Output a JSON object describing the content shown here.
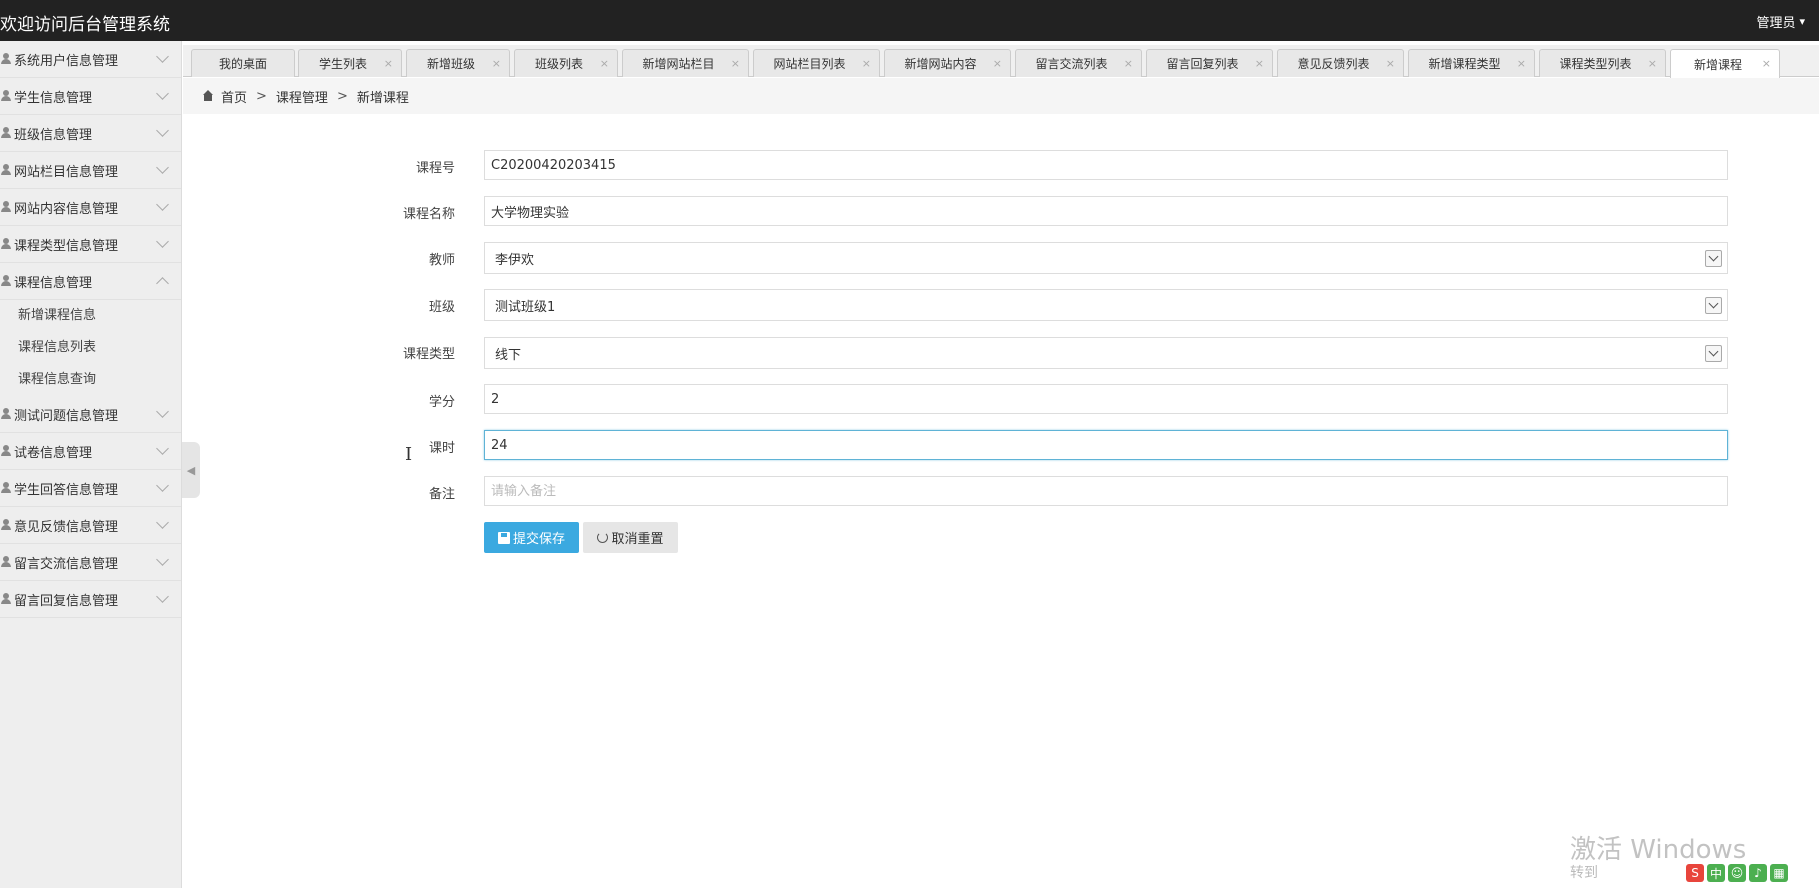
{
  "header": {
    "title": "欢迎访问后台管理系统",
    "user": "管理员"
  },
  "sidebar": {
    "items": [
      {
        "label": "系统用户信息管理"
      },
      {
        "label": "学生信息管理"
      },
      {
        "label": "班级信息管理"
      },
      {
        "label": "网站栏目信息管理"
      },
      {
        "label": "网站内容信息管理"
      },
      {
        "label": "课程类型信息管理"
      },
      {
        "label": "课程信息管理"
      },
      {
        "label": "测试问题信息管理"
      },
      {
        "label": "试卷信息管理"
      },
      {
        "label": "学生回答信息管理"
      },
      {
        "label": "意见反馈信息管理"
      },
      {
        "label": "留言交流信息管理"
      },
      {
        "label": "留言回复信息管理"
      }
    ],
    "submenu": [
      "新增课程信息",
      "课程信息列表",
      "课程信息查询"
    ]
  },
  "tabs": [
    "我的桌面",
    "学生列表",
    "新增班级",
    "班级列表",
    "新增网站栏目",
    "网站栏目列表",
    "新增网站内容",
    "留言交流列表",
    "留言回复列表",
    "意见反馈列表",
    "新增课程类型",
    "课程类型列表",
    "新增课程"
  ],
  "active_tab": "新增课程",
  "breadcrumb": {
    "home": "首页",
    "level1": "课程管理",
    "level2": "新增课程",
    "separator": ">"
  },
  "form": {
    "course_no": {
      "label": "课程号",
      "value": "C20200420203415"
    },
    "course_name": {
      "label": "课程名称",
      "value": "大学物理实验"
    },
    "teacher": {
      "label": "教师",
      "value": "李伊欢"
    },
    "class": {
      "label": "班级",
      "value": "测试班级1"
    },
    "course_type": {
      "label": "课程类型",
      "value": "线下"
    },
    "credit": {
      "label": "学分",
      "value": "2"
    },
    "hours": {
      "label": "课时",
      "value": "24"
    },
    "remark": {
      "label": "备注",
      "value": "",
      "placeholder": "请输入备注"
    }
  },
  "buttons": {
    "submit": "提交保存",
    "reset": "取消重置"
  },
  "watermark": {
    "line1": "激活 Windows",
    "line2": "转到"
  },
  "colors": {
    "topbar": "#222222",
    "primary": "#3ba9e0",
    "sidebar_bg": "#eeeeee"
  }
}
